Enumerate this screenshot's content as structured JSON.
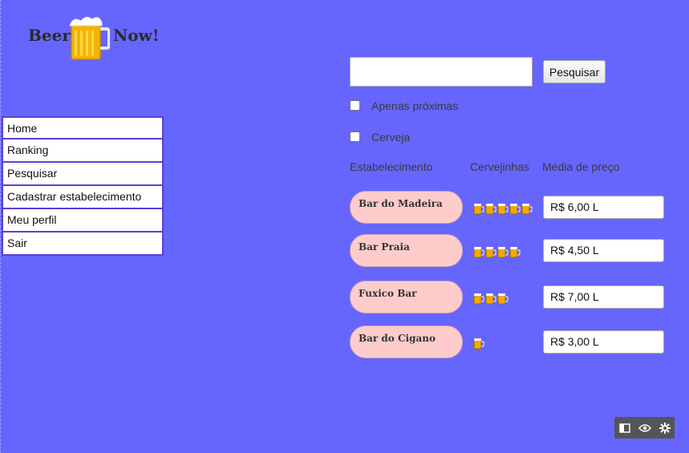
{
  "logo": {
    "left_text": "Beer",
    "right_text": "Now!"
  },
  "nav": {
    "items": [
      {
        "label": "Home"
      },
      {
        "label": "Ranking"
      },
      {
        "label": "Pesquisar"
      },
      {
        "label": "Cadastrar estabelecimento"
      },
      {
        "label": "Meu perfil"
      },
      {
        "label": "Sair"
      }
    ]
  },
  "search": {
    "value": "",
    "placeholder": "",
    "button_label": "Pesquisar"
  },
  "filters": [
    {
      "label": "Apenas próximas",
      "checked": false
    },
    {
      "label": "Cerveja",
      "checked": false
    }
  ],
  "results": {
    "headers": [
      "Estabelecimento",
      "Cervejinhas",
      "Média de preço"
    ],
    "rows": [
      {
        "name": "Bar do Madeira",
        "rating": 5,
        "price": "R$ 6,00 L"
      },
      {
        "name": "Bar Praia",
        "rating": 4,
        "price": "R$ 4,50 L"
      },
      {
        "name": "Fuxico Bar",
        "rating": 3,
        "price": "R$ 7,00 L"
      },
      {
        "name": "Bar do Cigano",
        "rating": 1,
        "price": "R$ 3,00 L"
      }
    ]
  },
  "toolbar_icons": [
    "panel-icon",
    "eye-icon",
    "gear-icon"
  ],
  "colors": {
    "background": "#6666ff",
    "pill": "#ffcccc",
    "nav_border": "#5b3fd6"
  }
}
